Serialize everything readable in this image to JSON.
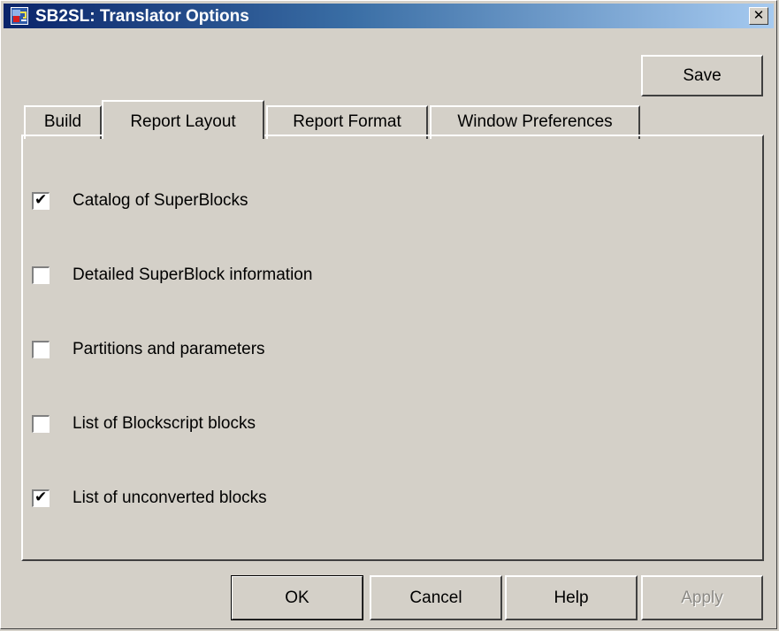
{
  "window": {
    "title": "SB2SL: Translator Options",
    "close_label": "✕"
  },
  "toolbar": {
    "save_label": "Save"
  },
  "tabs": [
    {
      "label": "Build",
      "active": false
    },
    {
      "label": "Report Layout",
      "active": true
    },
    {
      "label": "Report Format",
      "active": false
    },
    {
      "label": "Window Preferences",
      "active": false
    }
  ],
  "options": [
    {
      "label": "Catalog of SuperBlocks",
      "checked": true
    },
    {
      "label": "Detailed SuperBlock information",
      "checked": false
    },
    {
      "label": "Partitions and parameters",
      "checked": false
    },
    {
      "label": "List of Blockscript blocks",
      "checked": false
    },
    {
      "label": "List of unconverted blocks",
      "checked": true
    }
  ],
  "buttons": {
    "ok": "OK",
    "cancel": "Cancel",
    "help": "Help",
    "apply": "Apply"
  },
  "check_mark": "✔",
  "colors": {
    "title_start": "#0a246a",
    "title_end": "#a6caf0",
    "face": "#d4d0c8"
  }
}
